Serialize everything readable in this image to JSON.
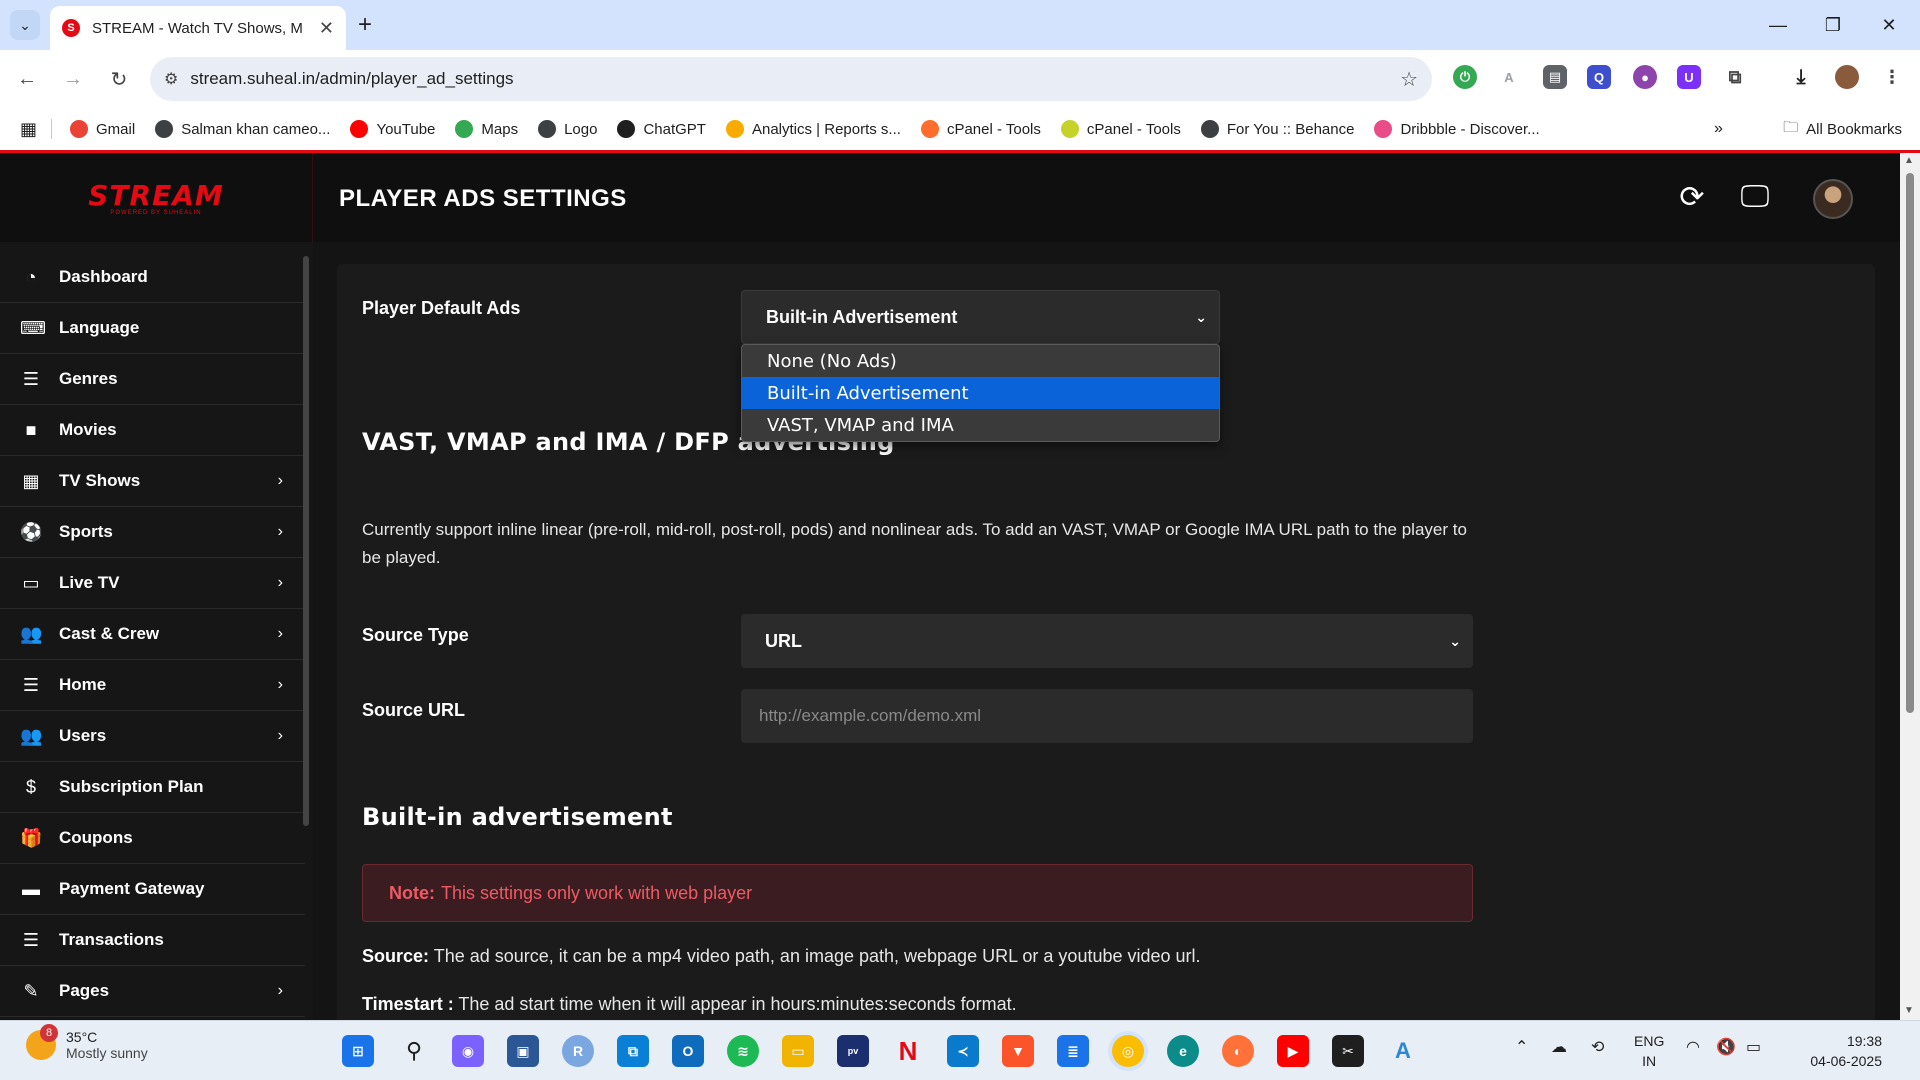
{
  "browser": {
    "tab_title": "STREAM - Watch TV Shows, Mo",
    "url": "stream.suheal.in/admin/player_ad_settings",
    "bookmarks": [
      {
        "label": "Gmail",
        "icon": "gmail-icon",
        "color": "#ea4335"
      },
      {
        "label": "Salman khan cameo...",
        "icon": "globe-icon",
        "color": "#3c4043"
      },
      {
        "label": "YouTube",
        "icon": "youtube-icon",
        "color": "#ff0000"
      },
      {
        "label": "Maps",
        "icon": "maps-icon",
        "color": "#34a853"
      },
      {
        "label": "Logo",
        "icon": "globe-icon",
        "color": "#3c4043"
      },
      {
        "label": "ChatGPT",
        "icon": "chatgpt-icon",
        "color": "#1f1f1f"
      },
      {
        "label": "Analytics | Reports s...",
        "icon": "analytics-icon",
        "color": "#f9ab00"
      },
      {
        "label": "cPanel - Tools",
        "icon": "cpanel-icon",
        "color": "#ff6c2c"
      },
      {
        "label": "cPanel - Tools",
        "icon": "cpanel-icon-2",
        "color": "#c6d22a"
      },
      {
        "label": "For You :: Behance",
        "icon": "globe-icon",
        "color": "#3c4043"
      },
      {
        "label": "Dribbble - Discover...",
        "icon": "dribbble-icon",
        "color": "#ea4c89"
      }
    ],
    "all_bookmarks": "All Bookmarks"
  },
  "app": {
    "logo": "STREAM",
    "logo_sub": "POWERED BY SUHEALIN",
    "page_title": "PLAYER ADS SETTINGS",
    "accent": "#e50914"
  },
  "sidebar": {
    "items": [
      {
        "label": "Dashboard",
        "icon": "dashboard-icon",
        "glyph": "◔",
        "arrow": false
      },
      {
        "label": "Language",
        "icon": "language-icon",
        "glyph": "⌨",
        "arrow": false
      },
      {
        "label": "Genres",
        "icon": "list-icon",
        "glyph": "☰",
        "arrow": false
      },
      {
        "label": "Movies",
        "icon": "video-camera-icon",
        "glyph": "■",
        "arrow": false
      },
      {
        "label": "TV Shows",
        "icon": "film-icon",
        "glyph": "▦",
        "arrow": true
      },
      {
        "label": "Sports",
        "icon": "soccer-ball-icon",
        "glyph": "⚽",
        "arrow": true
      },
      {
        "label": "Live TV",
        "icon": "monitor-icon",
        "glyph": "▭",
        "arrow": true
      },
      {
        "label": "Cast & Crew",
        "icon": "users-icon",
        "glyph": "👥",
        "arrow": true
      },
      {
        "label": "Home",
        "icon": "sliders-icon",
        "glyph": "☰",
        "arrow": true
      },
      {
        "label": "Users",
        "icon": "users-icon",
        "glyph": "👥",
        "arrow": true
      },
      {
        "label": "Subscription Plan",
        "icon": "dollar-icon",
        "glyph": "$",
        "arrow": false
      },
      {
        "label": "Coupons",
        "icon": "gift-icon",
        "glyph": "🎁",
        "arrow": false
      },
      {
        "label": "Payment Gateway",
        "icon": "credit-card-icon",
        "glyph": "▬",
        "arrow": false
      },
      {
        "label": "Transactions",
        "icon": "list-icon",
        "glyph": "☰",
        "arrow": false
      },
      {
        "label": "Pages",
        "icon": "edit-icon",
        "glyph": "✎",
        "arrow": true
      }
    ]
  },
  "form": {
    "default_ads_label": "Player Default Ads",
    "default_ads_value": "Built-in Advertisement",
    "default_ads_options": [
      "None (No Ads)",
      "Built-in Advertisement",
      "VAST, VMAP and IMA"
    ],
    "vast_title": "VAST, VMAP and IMA / DFP advertising",
    "vast_desc": "Currently support inline linear (pre-roll, mid-roll, post-roll, pods) and nonlinear ads. To add an VAST, VMAP or Google IMA URL path to the player to be played.",
    "source_type_label": "Source Type",
    "source_type_value": "URL",
    "source_url_label": "Source URL",
    "source_url_placeholder": "http://example.com/demo.xml",
    "builtin_title": "Built-in advertisement",
    "note_label": "Note:",
    "note_text": "This settings only work with web player",
    "source_key": "Source:",
    "source_desc": "The ad source, it can be a mp4 video path, an image path, webpage URL or a youtube video url.",
    "timestart_key": "Timestart :",
    "timestart_desc": "The ad start time when it will appear in hours:minutes:seconds format."
  },
  "taskbar": {
    "weather_badge": "8",
    "temperature": "35°C",
    "condition": "Mostly sunny",
    "lang_line1": "ENG",
    "lang_line2": "IN",
    "time": "19:38",
    "date": "04-06-2025"
  }
}
